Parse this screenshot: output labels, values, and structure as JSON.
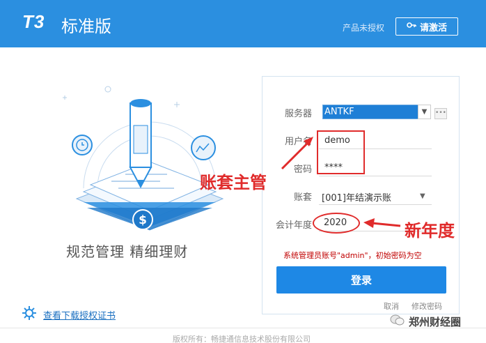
{
  "header": {
    "logo": "T3",
    "edition": "标准版",
    "license_status": "产品未授权",
    "activate_label": "请激活"
  },
  "left": {
    "slogan": "规范管理  精细理财",
    "cert_link": "查看下载授权证书"
  },
  "form": {
    "server_label": "服务器",
    "server_value": "ANTKF",
    "username_label": "用户名",
    "username_value": "demo",
    "password_label": "密码",
    "password_value": "****",
    "account_label": "账套",
    "account_value": "[001]年结演示账",
    "year_label": "会计年度",
    "year_value": "2020",
    "admin_note": "系统管理员账号\"admin\"，初始密码为空",
    "login_label": "登录",
    "cancel_label": "取消",
    "change_password_label": "修改密码"
  },
  "annotations": {
    "supervisor": "账套主管",
    "new_year": "新年度"
  },
  "footer": {
    "copyright": "版权所有：畅捷通信息技术股份有限公司",
    "watermark": "郑州财经圈"
  },
  "colors": {
    "header_bg": "#2b8fe0",
    "login_button": "#1e88e5",
    "annotation_red": "#e02b2b"
  }
}
